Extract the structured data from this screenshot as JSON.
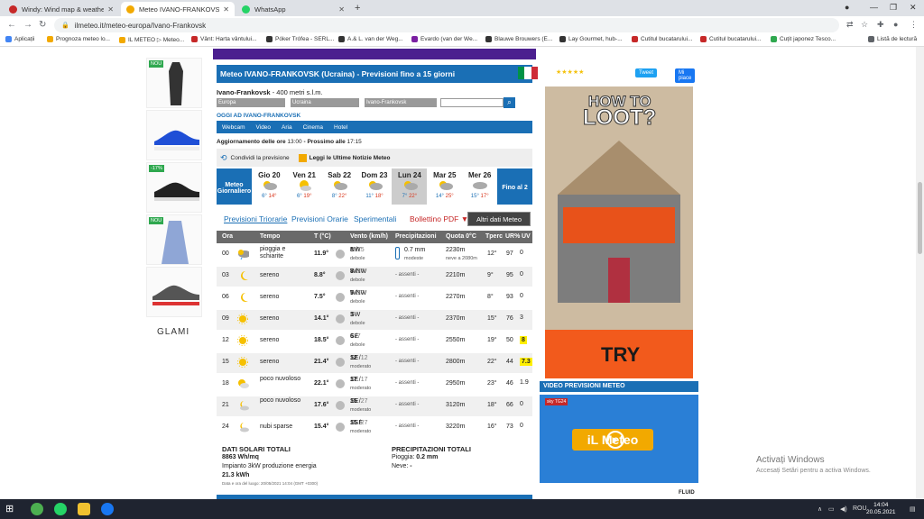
{
  "tabs": [
    {
      "label": "Windy: Wind map & weather fo",
      "color": "#c62828"
    },
    {
      "label": "Meteo IVANO-FRANKOVSK (Ucra",
      "color": "#f2a900"
    },
    {
      "label": "WhatsApp",
      "color": "#25d366"
    }
  ],
  "url": "ilmeteo.it/meteo-europa/Ivano-Frankovsk",
  "bookmarks": [
    "Aplicații",
    "Prognoza meteo lo...",
    "IL METEO ▷ Meteo...",
    "Vânt: Harta vântului...",
    "Póker Trófea - SERL...",
    "A.& L. van der Weg...",
    "Evardo (van der We...",
    "Blauwe Brouwers (E...",
    "Lay Gourmet, hub-...",
    "Cutitul bucatarului...",
    "Cutitul bucatarului...",
    "Cuțit japonez Tesco...",
    "Listă de lectură"
  ],
  "ads": {
    "nou": "NOU",
    "discount": "-17%",
    "brand": "GLAMI"
  },
  "header": {
    "title": "Meteo IVANO-FRANKOVSK (Ucraina) - Previsioni fino a 15 giorni",
    "stars": "★★★★★",
    "voti": "Voti!",
    "tweet": "Tweet",
    "like": "Mi piace"
  },
  "location": {
    "name": "Ivano-Frankovsk",
    "alt": " - 400 metri s.l.m.",
    "f1": "Europa",
    "f2": "Ucraina",
    "f3": "Ivano-Frankovsk",
    "oggi": "OGGI AD IVANO-FRANKOVSK"
  },
  "menu": [
    "Webcam",
    "Video",
    "Aria",
    "Cinema",
    "Hotel"
  ],
  "update": {
    "label": "Aggiornamento delle ore",
    "time": "13:00",
    "next_label": " - Prossimo alle",
    "next": "17:15"
  },
  "share": {
    "condividi": "Condividi la previsione",
    "news": "Leggi le Ultime Notizie Meteo"
  },
  "days": [
    {
      "name": "Meteo Giornaliero"
    },
    {
      "name": "Gio 20",
      "min": "6°",
      "max": "14°"
    },
    {
      "name": "Ven 21",
      "min": "6°",
      "max": "19°"
    },
    {
      "name": "Sab 22",
      "min": "8°",
      "max": "22°"
    },
    {
      "name": "Dom 23",
      "min": "11°",
      "max": "18°"
    },
    {
      "name": "Lun 24",
      "min": "7°",
      "max": "22°"
    },
    {
      "name": "Mar 25",
      "min": "14°",
      "max": "25°"
    },
    {
      "name": "Mer 26",
      "min": "15°",
      "max": "17°"
    },
    {
      "name": "Fino al 2"
    }
  ],
  "subtabs": {
    "t1": "Previsioni Triorarie",
    "t2": "Previsioni Orarie",
    "t3": "Sperimentali",
    "t4": "Bollettino PDF ▼",
    "altri": "Altri dati Meteo"
  },
  "cols": [
    "Ora",
    "Tempo",
    "T (°C)",
    "Vento (km/h)",
    "Precipitazioni",
    "Quota 0°C",
    "Tperc",
    "UR%",
    "UV"
  ],
  "rows": [
    {
      "ora": "00",
      "tempo": "pioggia e schiarite",
      "t": "11.9°",
      "dir": "NW",
      "v": "8",
      "raff": "15",
      "vd": "debole",
      "prec": "0.7 mm",
      "pd": "modeste",
      "quota": "2230m",
      "qn": "neve a 2080m",
      "tp": "12°",
      "ur": "97",
      "uv": "0",
      "icon": "rain"
    },
    {
      "ora": "03",
      "tempo": "sereno",
      "t": "8.8°",
      "dir": "WNW",
      "v": "8",
      "raff": "16",
      "vd": "debole",
      "prec": "- assenti -",
      "quota": "2210m",
      "tp": "9°",
      "ur": "95",
      "uv": "0",
      "icon": "moon"
    },
    {
      "ora": "06",
      "tempo": "sereno",
      "t": "7.5°",
      "dir": "WNW",
      "v": "5",
      "raff": "10",
      "vd": "debole",
      "prec": "- assenti -",
      "quota": "2270m",
      "tp": "8°",
      "ur": "93",
      "uv": "0",
      "icon": "moon"
    },
    {
      "ora": "09",
      "tempo": "sereno",
      "t": "14.1°",
      "dir": "SW",
      "v": "3",
      "raff": "",
      "vd": "debole",
      "prec": "- assenti -",
      "quota": "2370m",
      "tp": "15°",
      "ur": "76",
      "uv": "3",
      "icon": "sun"
    },
    {
      "ora": "12",
      "tempo": "sereno",
      "t": "18.5°",
      "dir": "SE",
      "v": "6",
      "raff": "7",
      "vd": "debole",
      "prec": "- assenti -",
      "quota": "2550m",
      "tp": "19°",
      "ur": "50",
      "uv": "8",
      "icon": "sun",
      "uvy": true
    },
    {
      "ora": "15",
      "tempo": "sereno",
      "t": "21.4°",
      "dir": "SE",
      "v": "12",
      "raff": "12",
      "vd": "moderato",
      "prec": "- assenti -",
      "quota": "2800m",
      "tp": "22°",
      "ur": "44",
      "uv": "7.3",
      "icon": "sun",
      "uvy": true
    },
    {
      "ora": "18",
      "tempo": "poco nuvoloso",
      "t": "22.1°",
      "dir": "SE",
      "v": "17",
      "raff": "17",
      "vd": "moderato",
      "prec": "- assenti -",
      "quota": "2950m",
      "tp": "23°",
      "ur": "46",
      "uv": "1.9",
      "icon": "suncloud"
    },
    {
      "ora": "21",
      "tempo": "poco nuvoloso",
      "t": "17.6°",
      "dir": "SE",
      "v": "15",
      "raff": "27",
      "vd": "moderato",
      "prec": "- assenti -",
      "quota": "3120m",
      "tp": "18°",
      "ur": "66",
      "uv": "0",
      "icon": "mooncloud"
    },
    {
      "ora": "24",
      "tempo": "nubi sparse",
      "t": "15.4°",
      "dir": "SSE",
      "v": "15",
      "raff": "27",
      "vd": "moderato",
      "prec": "- assenti -",
      "quota": "3220m",
      "tp": "16°",
      "ur": "73",
      "uv": "0",
      "icon": "mooncloud"
    }
  ],
  "solar": {
    "h": "DATI SOLARI TOTALI",
    "v": "8863 Wh/mq",
    "imp": "Impianto 3kW produzione energia",
    "kwh": "21.3 kWh",
    "time": "Data e ora del luogo: 20/05/2021 14:04 (GMT +0300)"
  },
  "prec": {
    "h": "PRECIPITAZIONI TOTALI",
    "pioggia": "Pioggia: ",
    "pv": "0.2 mm",
    "neve": "Neve: ",
    "nv": "-"
  },
  "banner": {
    "line1": "HOW TO",
    "line2": "LOOT?",
    "try": "TRY"
  },
  "video": {
    "h": "VIDEO PREVISIONI METEO",
    "logo": "iL Meteo",
    "sky": "sky TG24",
    "fluid": "FLUID"
  },
  "windows": {
    "act1": "Activați Windows",
    "act2": "Accesați Setări pentru a activa Windows.",
    "lang": "ROU",
    "time": "14:04",
    "date": "20.05.2021"
  }
}
